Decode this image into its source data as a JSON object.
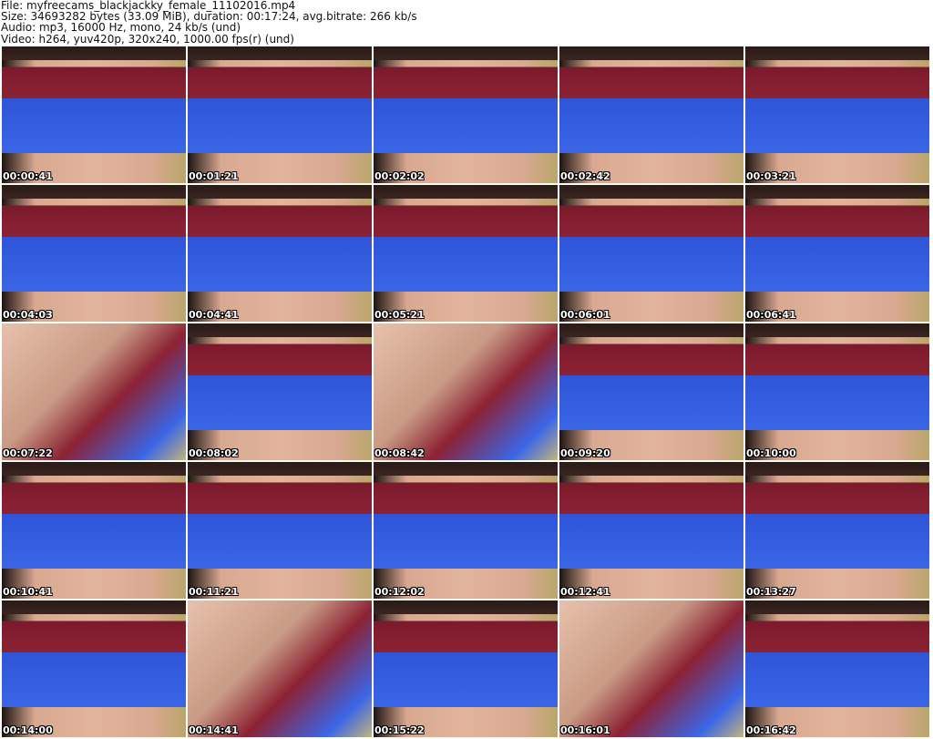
{
  "header": {
    "file": "File: myfreecams_blackjackky_female_11102016.mp4",
    "size": "Size: 34693282 bytes (33.09 MiB), duration: 00:17:24, avg.bitrate: 266 kb/s",
    "audio": "Audio: mp3, 16000 Hz, mono, 24 kb/s (und)",
    "video": "Video: h264, yuv420p, 320x240, 1000.00 fps(r) (und)"
  },
  "thumbnails": [
    "00:00:41",
    "00:01:21",
    "00:02:02",
    "00:02:42",
    "00:03:21",
    "00:04:03",
    "00:04:41",
    "00:05:21",
    "00:06:01",
    "00:06:41",
    "00:07:22",
    "00:08:02",
    "00:08:42",
    "00:09:20",
    "00:10:00",
    "00:10:41",
    "00:11:21",
    "00:12:02",
    "00:12:41",
    "00:13:27",
    "00:14:00",
    "00:14:41",
    "00:15:22",
    "00:16:01",
    "00:16:42"
  ]
}
